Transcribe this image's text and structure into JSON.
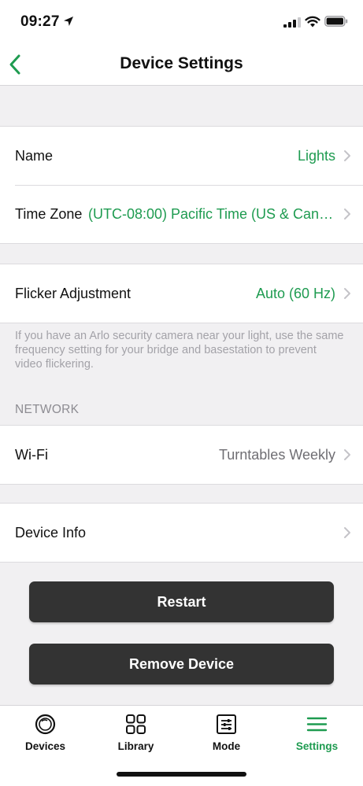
{
  "status_bar": {
    "time": "09:27"
  },
  "nav": {
    "title": "Device Settings"
  },
  "device_group": {
    "name_label": "Name",
    "name_value": "Lights",
    "timezone_label": "Time Zone",
    "timezone_value": "(UTC-08:00) Pacific Time (US & Canada)"
  },
  "flicker_group": {
    "label": "Flicker Adjustment",
    "value": "Auto (60 Hz)",
    "footnote": "If you have an Arlo security camera near your light, use the same frequency setting for your bridge and basestation to prevent video flickering."
  },
  "network": {
    "header": "NETWORK",
    "wifi_label": "Wi-Fi",
    "wifi_value": "Turntables Weekly"
  },
  "info_group": {
    "label": "Device Info"
  },
  "actions": {
    "restart": "Restart",
    "remove": "Remove Device"
  },
  "tabs": [
    {
      "label": "Devices",
      "icon": "devices-icon"
    },
    {
      "label": "Library",
      "icon": "library-grid-icon"
    },
    {
      "label": "Mode",
      "icon": "mode-sliders-icon"
    },
    {
      "label": "Settings",
      "icon": "settings-menu-icon",
      "active": true
    }
  ],
  "colors": {
    "accent": "#1e9b50",
    "button_bg": "#333333",
    "page_bg": "#f1f0f2"
  }
}
